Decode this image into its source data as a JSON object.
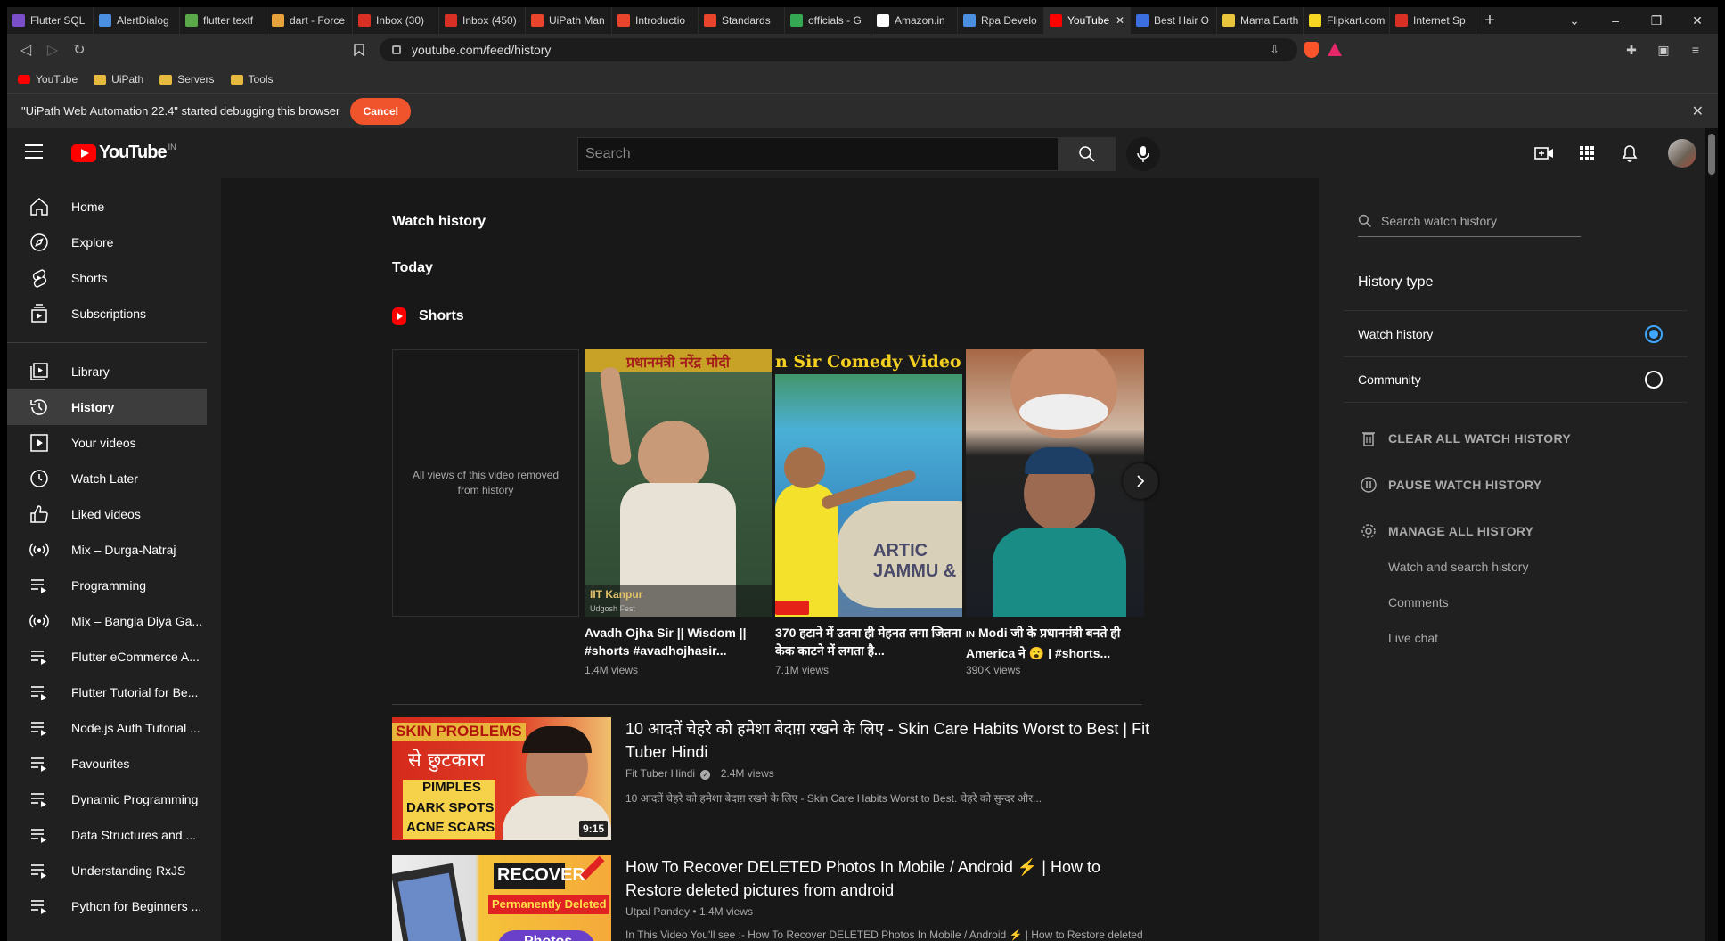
{
  "browser": {
    "tabs": [
      {
        "label": "Flutter SQL",
        "color": "#7a4fc9"
      },
      {
        "label": "AlertDialog",
        "color": "#4a8fe0"
      },
      {
        "label": "flutter textf",
        "color": "#5aa84a"
      },
      {
        "label": "dart - Force",
        "color": "#e6a23c"
      },
      {
        "label": "Inbox (30)",
        "color": "#d93025"
      },
      {
        "label": "Inbox (450)",
        "color": "#d93025"
      },
      {
        "label": "UiPath Man",
        "color": "#e8452c"
      },
      {
        "label": "Introductio",
        "color": "#e8452c"
      },
      {
        "label": "Standards",
        "color": "#e8452c"
      },
      {
        "label": "officials - G",
        "color": "#34a853"
      },
      {
        "label": "Amazon.in",
        "color": "#ffffff"
      },
      {
        "label": "Rpa Develo",
        "color": "#4a8fe0"
      },
      {
        "label": "YouTube",
        "color": "#ff0000",
        "active": true
      },
      {
        "label": "Best Hair O",
        "color": "#3b6fe0"
      },
      {
        "label": "Mama Earth",
        "color": "#e8c53c"
      },
      {
        "label": "Flipkart.com",
        "color": "#f5d623"
      },
      {
        "label": "Internet Sp",
        "color": "#d93025"
      }
    ],
    "new_tab": "+",
    "url": "youtube.com/feed/history",
    "bookmarks": [
      {
        "label": "YouTube",
        "icon": "youtube-icon"
      },
      {
        "label": "UiPath",
        "icon": "folder-icon"
      },
      {
        "label": "Servers",
        "icon": "folder-icon"
      },
      {
        "label": "Tools",
        "icon": "folder-icon"
      }
    ],
    "debug_message": "\"UiPath Web Automation 22.4\" started debugging this browser",
    "debug_cancel": "Cancel"
  },
  "masthead": {
    "logo_text": "YouTube",
    "country_code": "IN",
    "search_placeholder": "Search"
  },
  "guide": {
    "primary": [
      {
        "label": "Home",
        "icon": "home-icon"
      },
      {
        "label": "Explore",
        "icon": "explore-icon"
      },
      {
        "label": "Shorts",
        "icon": "shorts-icon"
      },
      {
        "label": "Subscriptions",
        "icon": "subscriptions-icon"
      }
    ],
    "library": [
      {
        "label": "Library",
        "icon": "library-icon"
      },
      {
        "label": "History",
        "icon": "history-icon",
        "active": true
      },
      {
        "label": "Your videos",
        "icon": "your-videos-icon"
      },
      {
        "label": "Watch Later",
        "icon": "watch-later-icon"
      },
      {
        "label": "Liked videos",
        "icon": "like-icon"
      },
      {
        "label": "Mix – Durga-Natraj",
        "icon": "mix-icon"
      },
      {
        "label": "Programming",
        "icon": "playlist-icon"
      },
      {
        "label": "Mix – Bangla Diya Ga...",
        "icon": "mix-icon"
      },
      {
        "label": "Flutter eCommerce A...",
        "icon": "playlist-icon"
      },
      {
        "label": "Flutter Tutorial for Be...",
        "icon": "playlist-icon"
      },
      {
        "label": "Node.js Auth Tutorial ...",
        "icon": "playlist-icon"
      },
      {
        "label": "Favourites",
        "icon": "playlist-icon"
      },
      {
        "label": "Dynamic Programming",
        "icon": "playlist-icon"
      },
      {
        "label": "Data Structures and ...",
        "icon": "playlist-icon"
      },
      {
        "label": "Understanding RxJS",
        "icon": "playlist-icon"
      },
      {
        "label": "Python for Beginners ...",
        "icon": "playlist-icon"
      }
    ]
  },
  "main": {
    "page_title": "Watch history",
    "section_today": "Today",
    "shorts_heading": "Shorts",
    "shorts": [
      {
        "removed": true,
        "removed_text": "All views of this video removed from history",
        "title": "",
        "views": ""
      },
      {
        "title": "Avadh Ojha Sir || Wisdom || #shorts #avadhojhasir...",
        "views": "1.4M views",
        "thumb_top": "प्रधानमंत्री नरेंद्र मोदी",
        "thumb_bottom": "IIT Kanpur",
        "thumb_caption": "Udgosh Fest"
      },
      {
        "title": "370 हटाने में उतना ही मेहनत लगा जितना केक काटने में लगता है...",
        "views": "7.1M views",
        "thumb_top": "n Sir Comedy Video",
        "thumb_bottom": "ARTIC JAMMU &"
      },
      {
        "title": "Modi जी के प्रधानमंत्री बनते ही America ने 😮 | #shorts...",
        "views": "390K views",
        "title_prefix": "IN"
      }
    ],
    "videos": [
      {
        "title": "10 आदतें चेहरे को हमेशा बेदाग़ रखने के लिए - Skin Care Habits Worst to Best | Fit Tuber Hindi",
        "channel": "Fit Tuber Hindi",
        "verified": true,
        "views": "2.4M views",
        "description": "10 आदतें चेहरे को हमेशा बेदाग़ रखने के लिए - Skin Care Habits Worst to Best. चेहरे को सुन्दर और...",
        "duration": "9:15",
        "thumb_lines": [
          "SKIN PROBLEMS",
          "से छुटकारा",
          "PIMPLES",
          "DARK SPOTS",
          "ACNE SCARS"
        ]
      },
      {
        "title": "How To Recover DELETED Photos In Mobile / Android ⚡ | How to Restore deleted pictures from android",
        "channel": "Utpal Pandey",
        "verified": false,
        "views": "1.4M views",
        "description": "In This Video You'll see :- How To Recover DELETED Photos In Mobile / Android ⚡ | How to Restore deleted",
        "duration": "",
        "thumb_lines": [
          "RECOVER",
          "Permanently Deleted",
          "Photos"
        ]
      }
    ]
  },
  "right_panel": {
    "search_placeholder": "Search watch history",
    "history_type_title": "History type",
    "history_types": [
      {
        "label": "Watch history",
        "selected": true
      },
      {
        "label": "Community",
        "selected": false
      }
    ],
    "actions": [
      {
        "label": "CLEAR ALL WATCH HISTORY",
        "icon": "trash-icon"
      },
      {
        "label": "PAUSE WATCH HISTORY",
        "icon": "pause-icon"
      },
      {
        "label": "MANAGE ALL HISTORY",
        "icon": "gear-icon"
      }
    ],
    "manage_links": [
      "Watch and search history",
      "Comments",
      "Live chat"
    ]
  },
  "colors": {
    "accent_red": "#ff0000",
    "radio_blue": "#3ea6ff",
    "cancel_orange": "#f0542d"
  }
}
